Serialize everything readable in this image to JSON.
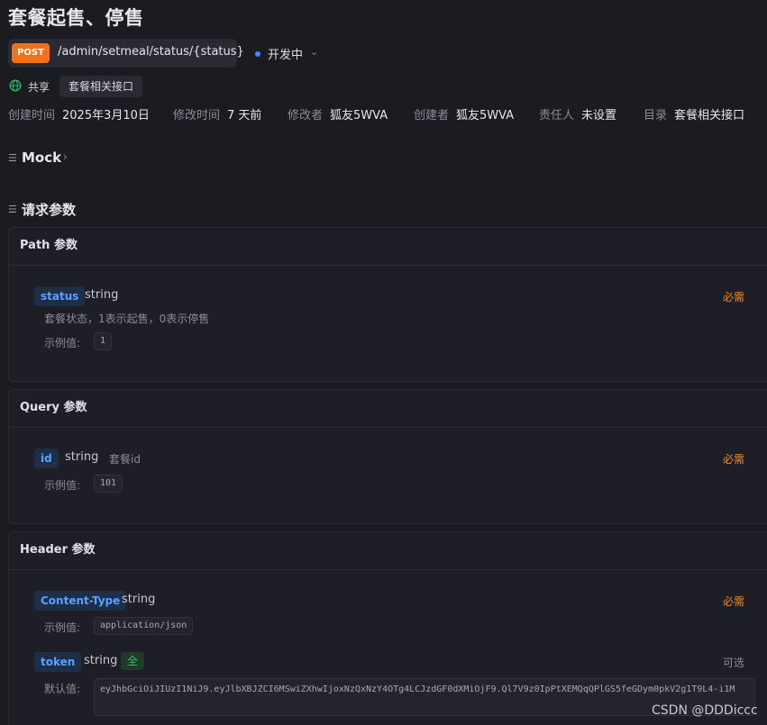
{
  "page": {
    "title": "套餐起售、停售",
    "method": "POST",
    "path": "/admin/setmeal/status/{status}",
    "status": "开发中",
    "share_label": "共享",
    "folder_tag": "套餐相关接口"
  },
  "meta": [
    {
      "label": "创建时间",
      "value": "2025年3月10日"
    },
    {
      "label": "修改时间",
      "value": "7 天前"
    },
    {
      "label": "修改者",
      "value": "狐友5WVA"
    },
    {
      "label": "创建者",
      "value": "狐友5WVA"
    },
    {
      "label": "责任人",
      "value": "未设置"
    },
    {
      "label": "目录",
      "value": "套餐相关接口"
    }
  ],
  "sections": {
    "mock": "Mock",
    "request_params": "请求参数"
  },
  "path_params": {
    "header": "Path 参数",
    "params": [
      {
        "name": "status",
        "type": "string",
        "required": "必需",
        "desc": "套餐状态，1表示起售，0表示停售",
        "example_label": "示例值:",
        "example": "1"
      }
    ]
  },
  "query_params": {
    "header": "Query 参数",
    "params": [
      {
        "name": "id",
        "type": "string",
        "desc": "套餐id",
        "required": "必需",
        "example_label": "示例值:",
        "example": "101"
      }
    ]
  },
  "header_params": {
    "header": "Header 参数",
    "params": [
      {
        "name": "Content-Type",
        "type": "string",
        "required": "必需",
        "example_label": "示例值:",
        "example": "application/json"
      },
      {
        "name": "token",
        "type": "string",
        "badge": "全",
        "required": "可选",
        "default_label": "默认值:",
        "default": "eyJhbGciOiJIUzI1NiJ9.eyJlbXBJZCI6MSwiZXhwIjoxNzQxNzY4OTg4LCJzdGF0dXMiOjF9.Ql7V9z0IpPtXEMQqQPlGS5feGDym0pkV2g1T9L4-i1M"
      }
    ]
  },
  "watermark": "CSDN @DDDiccc",
  "colors": {
    "method_bg": "#f2721c",
    "status_dot": "#3a8ef6",
    "required": "#f08a2a",
    "param_name": "#5aa0ff",
    "badge_green": "#33c26d"
  }
}
